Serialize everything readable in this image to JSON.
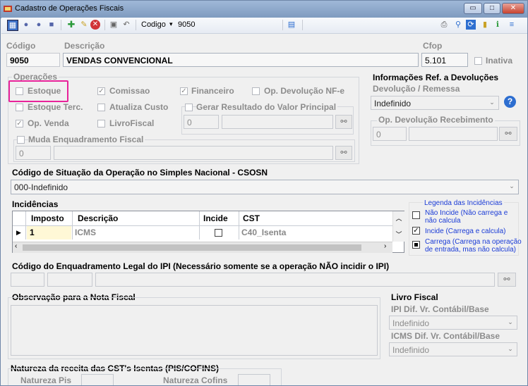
{
  "window": {
    "title": "Cadastro de Operações Fiscais",
    "minimize_label": "▭",
    "maximize_label": "□",
    "close_label": "✕"
  },
  "toolbar": {
    "search_field_label": "Codigo",
    "search_value": "9050"
  },
  "header": {
    "codigo_label": "Código",
    "codigo_value": "9050",
    "descricao_label": "Descrição",
    "descricao_value": "VENDAS CONVENCIONAL",
    "cfop_label": "Cfop",
    "cfop_value": "5.101",
    "inativa_label": "Inativa"
  },
  "operacoes": {
    "title": "Operações",
    "estoque": "Estoque",
    "comissao": "Comissao",
    "financeiro": "Financeiro",
    "op_devolucao_nfe": "Op. Devolução NF-e",
    "estoque_terc": "Estoque Terc.",
    "atualiza_custo": "Atualiza Custo",
    "gerar_resultado": "Gerar Resultado do Valor Principal",
    "gerar_resultado_value": "0",
    "op_venda": "Op. Venda",
    "livro_fiscal": "LivroFiscal",
    "muda_enquadramento": "Muda Enquadramento Fiscal",
    "muda_enquadramento_value": "0"
  },
  "devolucoes": {
    "title": "Informações Ref. a Devoluções",
    "devolucao_remessa_label": "Devolução / Remessa",
    "devolucao_remessa_value": "Indefinido",
    "help_label": "?",
    "op_devolucao_recebimento_label": "Op. Devolução Recebimento",
    "op_devolucao_recebimento_value": "0"
  },
  "csosn": {
    "title": "Código de Situação da Operação no Simples Nacional - CSOSN",
    "value": "000-Indefinido"
  },
  "incidencias": {
    "title": "Incidências",
    "columns": [
      "Imposto",
      "Descrição",
      "Incide",
      "CST"
    ],
    "rows": [
      {
        "imposto": "1",
        "descricao": "ICMS",
        "incide": false,
        "cst": "C40_Isenta"
      }
    ]
  },
  "legenda": {
    "title": "Legenda das Incidências",
    "items": [
      {
        "text_line1": "Não Incide (Não carrega e",
        "text_line2": "não calcula"
      },
      {
        "text_line1": "Incide (Carrega e calcula)",
        "text_line2": ""
      },
      {
        "text_line1": "Carrega (Carrega na operação",
        "text_line2": "de entrada, mas não calcula)"
      }
    ]
  },
  "ipi": {
    "title": "Código do Enquadramento Legal do IPI (Necessário somente se a operação NÃO incidir o IPI)"
  },
  "observacao": {
    "title": "Observação para a Nota Fiscal"
  },
  "livro_fiscal": {
    "title": "Livro Fiscal",
    "ipi_label": "IPI Dif. Vr. Contábil/Base",
    "ipi_value": "Indefinido",
    "icms_label": "ICMS Dif. Vr. Contábil/Base",
    "icms_value": "Indefinido"
  },
  "natureza": {
    "title": "Natureza da receita das CST's Isentas (PIS/COFINS)",
    "pis_label": "Natureza Pis",
    "cofins_label": "Natureza Cofins"
  }
}
